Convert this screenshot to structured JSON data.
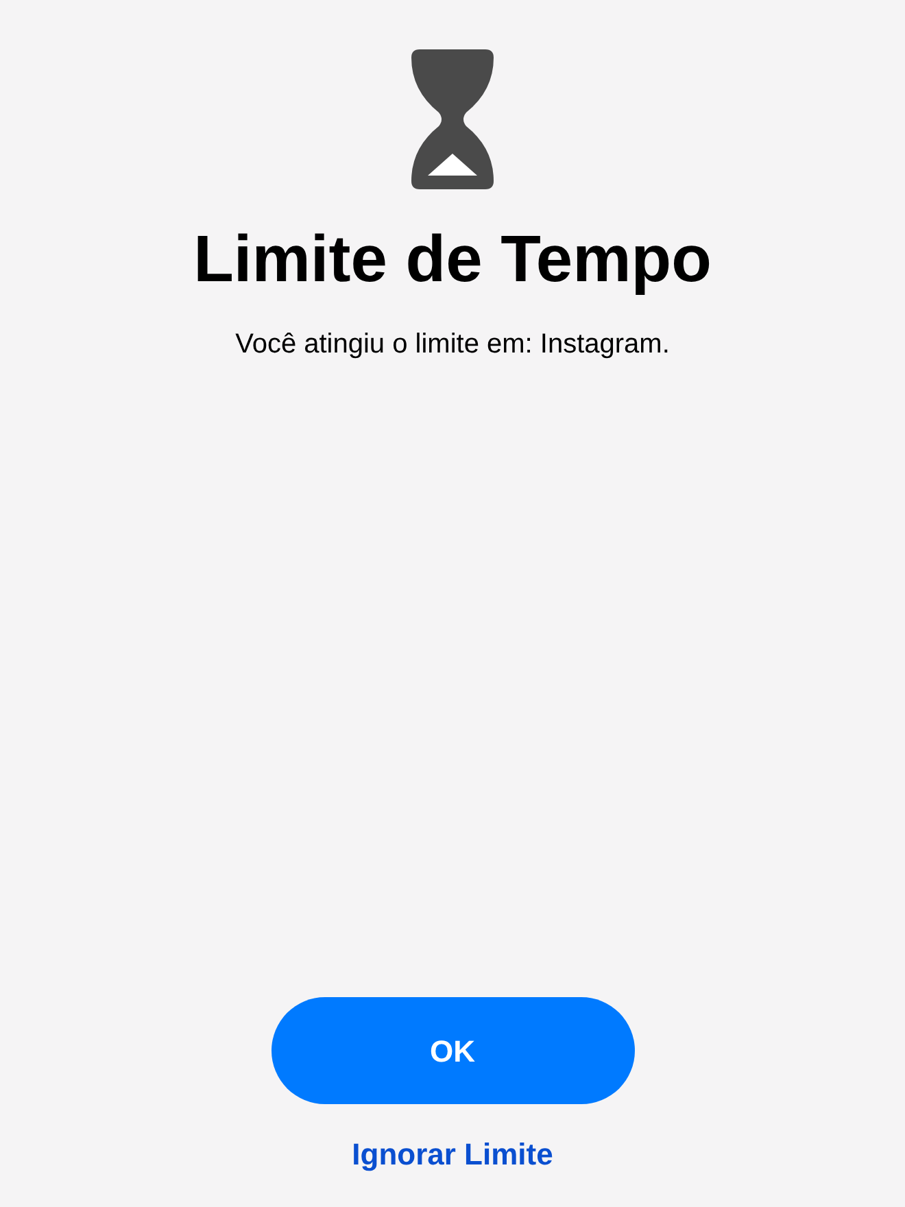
{
  "title": "Limite de Tempo",
  "message": "Você atingiu o limite em: Instagram.",
  "buttons": [
    {
      "kind": "primary",
      "label": "OK"
    },
    {
      "kind": "link",
      "label": "Ignorar Limite"
    }
  ]
}
